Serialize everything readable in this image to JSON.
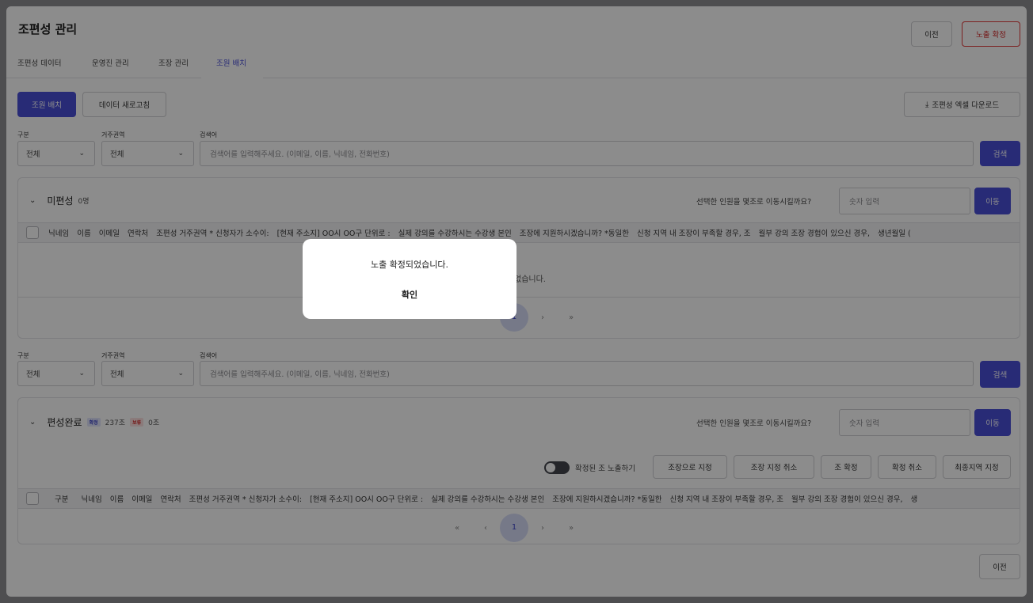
{
  "header": {
    "title": "조편성 관리",
    "prev_label": "이전",
    "confirm_exposure_label": "노출 확정"
  },
  "tabs": [
    {
      "label": "조편성 데이터"
    },
    {
      "label": "운영진 관리"
    },
    {
      "label": "조장 관리"
    },
    {
      "label": "조원 배치",
      "active": true
    }
  ],
  "toolbar": {
    "assign_label": "조원 배치",
    "refresh_label": "데이터 새로고침",
    "download_label": "조편성 엑셀 다운로드"
  },
  "filters": {
    "category_label": "구분",
    "region_label": "거주권역",
    "search_label": "검색어",
    "category_value": "전체",
    "region_value": "전체",
    "search_placeholder": "검색어를 입력해주세요. (이메일, 이름, 닉네임, 전화번호)",
    "search_button": "검색"
  },
  "unassigned": {
    "title": "미편성",
    "count": "0명",
    "move_prompt": "선택한 인원을 몇조로 이동시킬까요?",
    "move_placeholder": "숫자 입력",
    "move_button": "이동",
    "columns": [
      "닉네임",
      "이름",
      "이메일",
      "연락처",
      "조편성 거주권역 * 신청자가 소수이:",
      "[현재 주소지] OO시 OO구 단위로 :",
      "실제 강의를 수강하시는 수강생 본인",
      "조장에 지원하시겠습니까? *동일한",
      "신청 지역 내 조장이 부족할 경우, 조",
      "월부 강의 조장 경험이 있으신 경우,",
      "생년월일 ("
    ],
    "empty_text": "없습니다.",
    "pager": {
      "first": "«",
      "prev": "‹",
      "current": "1",
      "next": "›",
      "last": "»"
    }
  },
  "completed": {
    "title": "편성완료",
    "confirmed_badge": "확정",
    "confirmed_count": "237조",
    "hold_badge": "보류",
    "hold_count": "0조",
    "move_prompt": "선택한 인원을 몇조로 이동시킬까요?",
    "move_placeholder": "숫자 입력",
    "move_button": "이동",
    "toggle_label": "확정된 조 노출하기",
    "actions": [
      "조장으로 지정",
      "조장 지정 취소",
      "조 확정",
      "확정 취소",
      "최종지역 지정"
    ],
    "columns": [
      "구분",
      "닉네임",
      "이름",
      "이메일",
      "연락처",
      "조편성 거주권역 * 신청자가 소수이:",
      "[현재 주소지] OO시 OO구 단위로 :",
      "실제 강의를 수강하시는 수강생 본인",
      "조장에 지원하시겠습니까? *동일한",
      "신청 지역 내 조장이 부족할 경우, 조",
      "월부 강의 조장 경험이 있으신 경우,",
      "생"
    ],
    "pager": {
      "first": "«",
      "prev": "‹",
      "current": "1",
      "next": "›",
      "last": "»"
    }
  },
  "footer": {
    "prev_label": "이전"
  },
  "modal": {
    "message": "노출 확정되었습니다.",
    "ok_label": "확인"
  },
  "colors": {
    "primary": "#4a4fd8",
    "danger": "#d42b2b",
    "overlay": "rgba(0,0,0,0.45)"
  }
}
